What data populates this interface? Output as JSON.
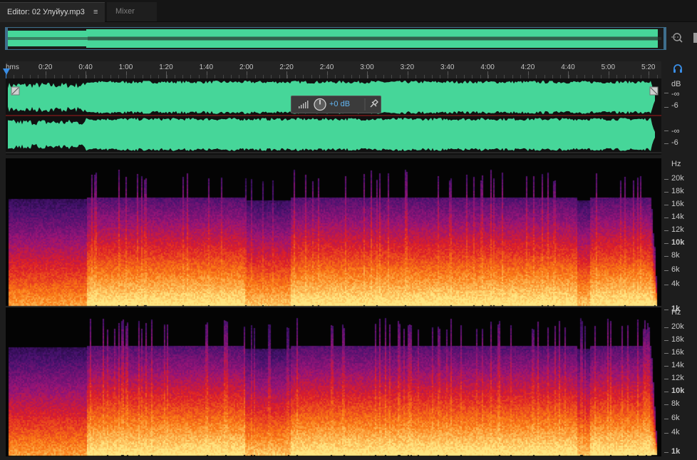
{
  "tabs": {
    "editor_label": "Editor: 02 Улуйуу.mp3",
    "menu_glyph": "≡",
    "mixer_label": "Mixer"
  },
  "ruler": {
    "unit_label": "hms",
    "times": [
      "0:20",
      "0:40",
      "1:00",
      "1:20",
      "1:40",
      "2:00",
      "2:20",
      "2:40",
      "3:00",
      "3:20",
      "3:40",
      "4:00",
      "4:20",
      "4:40",
      "5:00",
      "5:20"
    ]
  },
  "hud": {
    "gain_value": "+0 dB"
  },
  "amp_scale": {
    "unit": "dB",
    "ch1": [
      "-∞",
      "-6"
    ],
    "ch2": [
      "-∞",
      "-6"
    ]
  },
  "freq_scale": {
    "unit": "Hz",
    "labels": [
      "20k",
      "18k",
      "16k",
      "14k",
      "12k",
      "10k",
      "8k",
      "6k",
      "4k",
      "1k"
    ]
  },
  "colors": {
    "waveform": "#46d699",
    "selection_border": "#3e6e8c",
    "playhead": "#3a8ee6",
    "hud_value": "#62b4f0"
  },
  "icons": [
    "menu-icon",
    "zoom-icon",
    "headphones-icon",
    "playhead-icon",
    "fade-in-handle-icon",
    "fade-out-handle-icon",
    "volume-meter-icon",
    "volume-knob-icon",
    "pin-icon"
  ]
}
